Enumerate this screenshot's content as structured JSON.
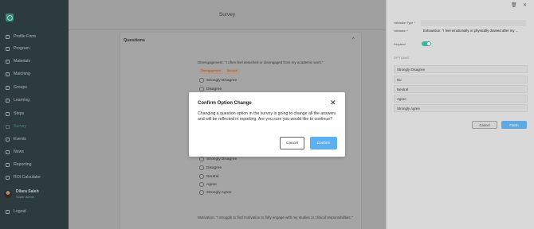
{
  "sidebar": {
    "items": [
      {
        "label": "Profile Form",
        "icon": "profile-icon"
      },
      {
        "label": "Program",
        "icon": "home-icon"
      },
      {
        "label": "Materials",
        "icon": "folder-icon"
      },
      {
        "label": "Matching",
        "icon": "matching-icon"
      },
      {
        "label": "Groups",
        "icon": "groups-icon"
      },
      {
        "label": "Learning",
        "icon": "learning-icon"
      },
      {
        "label": "Steps",
        "icon": "steps-icon"
      },
      {
        "label": "Survey",
        "icon": "survey-icon",
        "active": true
      },
      {
        "label": "Events",
        "icon": "calendar-icon"
      },
      {
        "label": "News",
        "icon": "news-icon"
      },
      {
        "label": "Reporting",
        "icon": "chart-icon"
      },
      {
        "label": "ROI Calculator",
        "icon": "calculator-icon"
      }
    ],
    "user": {
      "name": "Dilara Saleh",
      "role": "Super Admin"
    },
    "logout": "Logout",
    "accent": "#38b79a"
  },
  "main": {
    "title": "Survey",
    "section": "Questions",
    "question1": "Disengagement: \"I often feel detached or disengaged from my academic work.\"",
    "tags": [
      "Disengagement",
      "Burnout"
    ],
    "options_top": [
      "Strongly Disagree",
      "Disagree"
    ],
    "options_bottom": [
      "Strongly Disagree",
      "Disagree",
      "Neutral",
      "Agree",
      "Strongly Agree"
    ],
    "question2": "Motivation: \"I struggle to find motivation to fully engage with my studies or clinical responsibilities.\""
  },
  "panel": {
    "validation_type_label": "Validation Type *",
    "validation_label": "Validation *",
    "validation_value": "Exhaustion: \"I feel emotionally or physically drained after my ...",
    "required_label": "Required",
    "options_header": "OPTIONS",
    "options": [
      "Strongly Disagree",
      "No",
      "Neutral",
      "Agree",
      "Strongly Agree"
    ],
    "cancel": "Cancel",
    "finish": "Finish"
  },
  "dialog": {
    "title": "Confirm Option Change",
    "message": "Changing a question option in the survey is going to change all the answers and will be reflected in reporting. Are you sure you would like to continue?",
    "cancel": "Cancel",
    "confirm": "Confirm"
  }
}
